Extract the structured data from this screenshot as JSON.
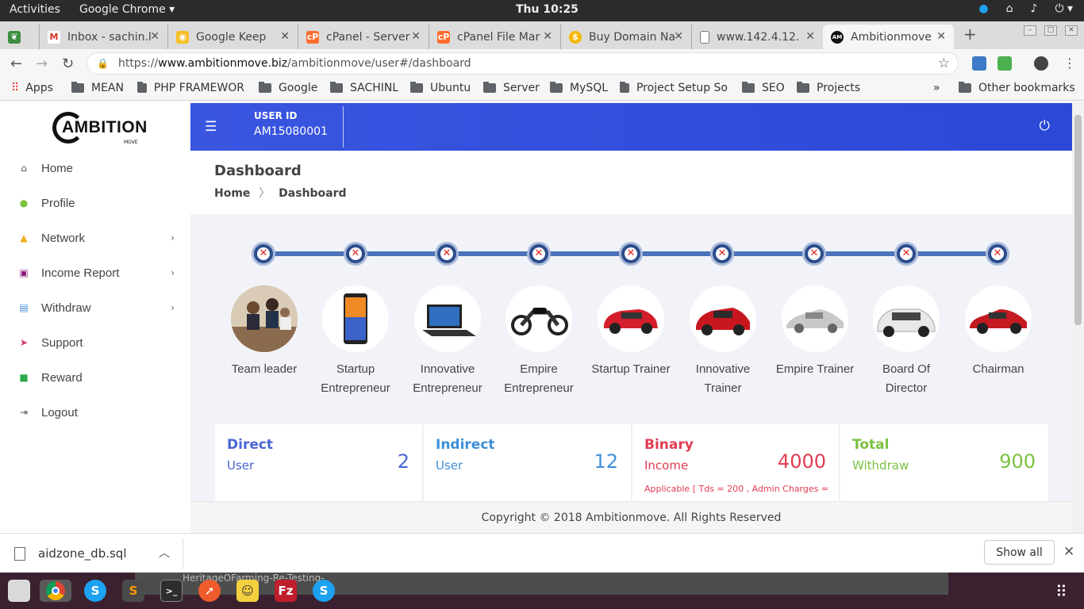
{
  "topbar": {
    "activities": "Activities",
    "app": "Google Chrome ▾",
    "clock": "Thu 10:25"
  },
  "tabs": [
    {
      "label": "Inbox - sachin.l"
    },
    {
      "label": "Google Keep"
    },
    {
      "label": "cPanel - Server"
    },
    {
      "label": "cPanel File Mar"
    },
    {
      "label": "Buy Domain Na"
    },
    {
      "label": "www.142.4.12."
    },
    {
      "label": "Ambitionmove"
    }
  ],
  "address": {
    "url_prefix": "https://",
    "url_host": "www.ambitionmove.biz",
    "url_path": "/ambitionmove/user#/dashboard"
  },
  "bookmarks": [
    "Apps",
    "MEAN",
    "PHP FRAMEWOR",
    "Google",
    "SACHINL",
    "Ubuntu",
    "Server",
    "MySQL",
    "Project Setup So",
    "SEO",
    "Projects",
    "»",
    "Other bookmarks"
  ],
  "sidebar": {
    "logo_text": "AMBITION",
    "logo_sub": "MOVE",
    "items": [
      {
        "label": "Home",
        "icon": "home-icon",
        "color": "#555555"
      },
      {
        "label": "Profile",
        "icon": "user-icon",
        "color": "#7cc142"
      },
      {
        "label": "Network",
        "icon": "network-icon",
        "color": "#f0ad1e"
      },
      {
        "label": "Income Report",
        "icon": "money-icon",
        "color": "#8b1c7a"
      },
      {
        "label": "Withdraw",
        "icon": "card-icon",
        "color": "#3f8fd6"
      },
      {
        "label": "Support",
        "icon": "send-icon",
        "color": "#d6306a"
      },
      {
        "label": "Reward",
        "icon": "briefcase-icon",
        "color": "#2aa84a"
      },
      {
        "label": "Logout",
        "icon": "sign-out-icon",
        "color": "#555555"
      }
    ]
  },
  "header": {
    "user_id_label": "USER ID",
    "user_id": "AM15080001"
  },
  "page": {
    "title": "Dashboard",
    "crumb_home": "Home",
    "crumb_sep": "〉",
    "crumb_current": "Dashboard"
  },
  "ranks": [
    {
      "label": "Team leader",
      "achieved": false
    },
    {
      "label": "Startup Entrepreneur",
      "achieved": false
    },
    {
      "label": "Innovative Entrepreneur",
      "achieved": false
    },
    {
      "label": "Empire Entrepreneur",
      "achieved": false
    },
    {
      "label": "Startup Trainer",
      "achieved": false
    },
    {
      "label": "Innovative Trainer",
      "achieved": false
    },
    {
      "label": "Empire Trainer",
      "achieved": false
    },
    {
      "label": "Board Of Director",
      "achieved": false
    },
    {
      "label": "Chairman",
      "achieved": false
    }
  ],
  "stats": [
    {
      "title": "Direct",
      "sub": "User",
      "value": "2",
      "color": "#4a64d6"
    },
    {
      "title": "Indirect",
      "sub": "User",
      "value": "12",
      "color": "#3e8fd8"
    },
    {
      "title": "Binary",
      "sub": "Income",
      "value": "4000",
      "color": "#e23c52",
      "note": "Applicable [ Tds = 200 , Admin Charges ="
    },
    {
      "title": "Total",
      "sub": "Withdraw",
      "value": "900",
      "color": "#7cc142"
    }
  ],
  "footer": {
    "copyright": "Copyright © 2018 Ambitionmove. All Rights Reserved"
  },
  "download": {
    "file": "aidzone_db.sql",
    "show_all": "Show all"
  },
  "dock_ghost": "HeritageOFarming-Re-Testing-"
}
